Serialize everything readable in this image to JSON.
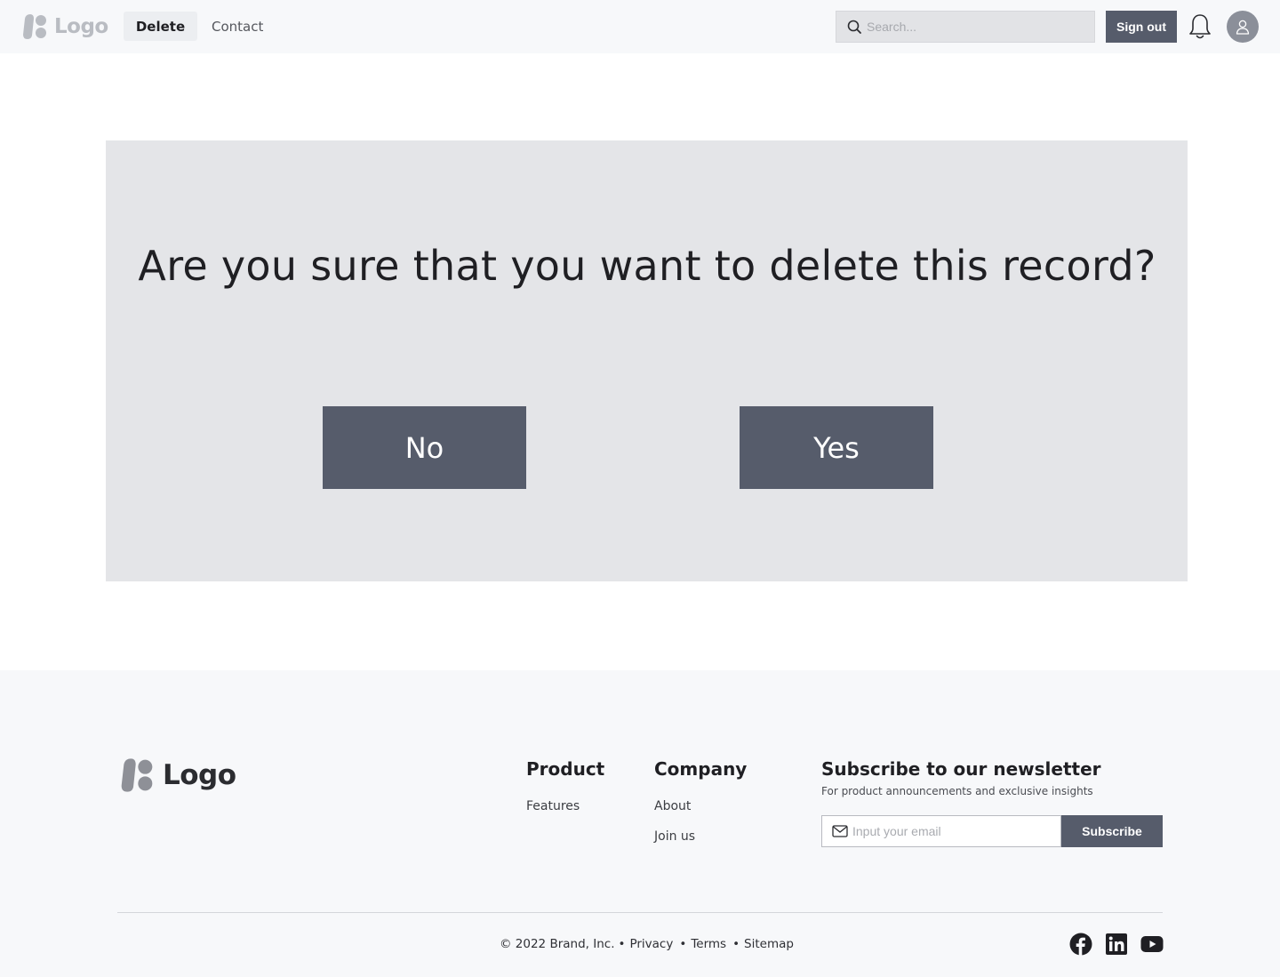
{
  "header": {
    "logo_text": "Logo",
    "nav": {
      "delete": "Delete",
      "contact": "Contact"
    },
    "search": {
      "placeholder": "Search..."
    },
    "signout_label": "Sign out",
    "icons": {
      "search": "search-icon",
      "bell": "bell-icon",
      "avatar": "user-icon"
    }
  },
  "dialog": {
    "question": "Are you sure that you want to delete this record?",
    "no_label": "No",
    "yes_label": "Yes"
  },
  "footer": {
    "logo_text": "Logo",
    "product": {
      "heading": "Product",
      "links": [
        "Features"
      ]
    },
    "company": {
      "heading": "Company",
      "links": [
        "About",
        "Join us"
      ]
    },
    "newsletter": {
      "heading": "Subscribe to our newsletter",
      "subtitle": "For product announcements and exclusive insights",
      "email_placeholder": "Input your email",
      "subscribe_label": "Subscribe"
    },
    "copyright": "© 2022 Brand, Inc.",
    "bottom_links": [
      "Privacy",
      "Terms",
      "Sitemap"
    ],
    "social": [
      "facebook-icon",
      "linkedin-icon",
      "youtube-icon"
    ]
  },
  "colors": {
    "accent": "#565c6b",
    "dialog_bg": "#e4e5e8",
    "header_bg": "#f7f8fa"
  }
}
